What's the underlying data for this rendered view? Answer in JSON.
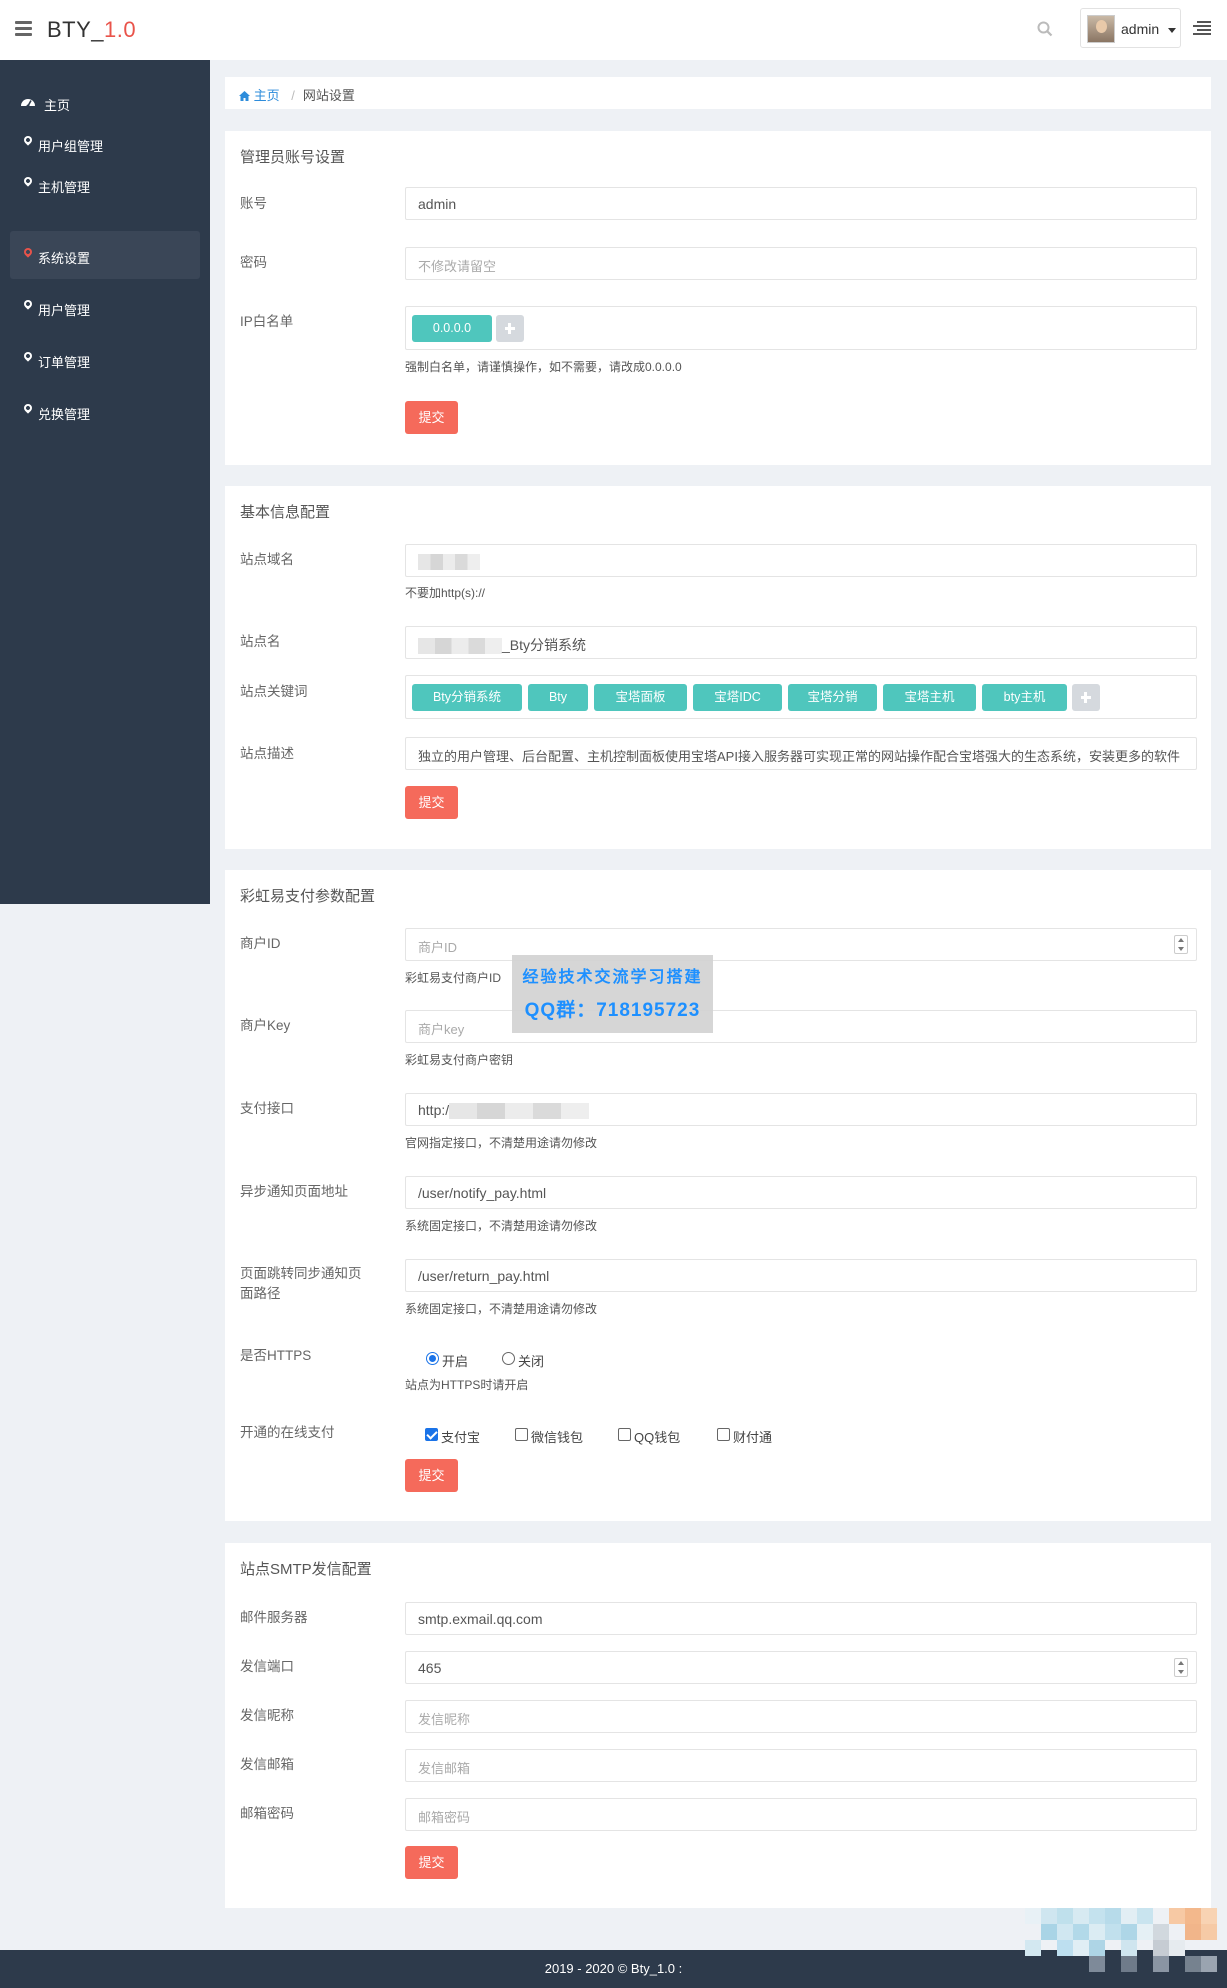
{
  "header": {
    "brand_prefix": "BTY_",
    "brand_version": "1.0",
    "username": "admin"
  },
  "sidebar": {
    "items": [
      {
        "label": "主页"
      },
      {
        "label": "用户组管理"
      },
      {
        "label": "主机管理"
      },
      {
        "label": "系统设置"
      },
      {
        "label": "用户管理"
      },
      {
        "label": "订单管理"
      },
      {
        "label": "兑换管理"
      }
    ],
    "active_index": 3
  },
  "breadcrumb": {
    "home": "主页",
    "current": "网站设置"
  },
  "admin_panel": {
    "title": "管理员账号设置",
    "account_label": "账号",
    "account_value": "admin",
    "password_label": "密码",
    "password_placeholder": "不修改请留空",
    "ip_label": "IP白名单",
    "ip_tags": [
      "0.0.0.0"
    ],
    "ip_help": "强制白名单，请谨慎操作，如不需要，请改成0.0.0.0",
    "submit": "提交"
  },
  "basic_panel": {
    "title": "基本信息配置",
    "domain_label": "站点域名",
    "domain_help": "不要加http(s)://",
    "sitename_label": "站点名",
    "sitename_value": "_Bty分销系统",
    "keywords_label": "站点关键词",
    "keywords": [
      "Bty分销系统",
      "Bty",
      "宝塔面板",
      "宝塔IDC",
      "宝塔分销",
      "宝塔主机",
      "bty主机"
    ],
    "desc_label": "站点描述",
    "desc_value": "独立的用户管理、后台配置、主机控制面板使用宝塔API接入服务器可实现正常的网站操作配合宝塔强大的生态系统，安装更多的软件",
    "submit": "提交"
  },
  "pay_panel": {
    "title": "彩虹易支付参数配置",
    "merchant_id_label": "商户ID",
    "merchant_id_placeholder": "商户ID",
    "merchant_id_help": "彩虹易支付商户ID",
    "merchant_key_label": "商户Key",
    "merchant_key_placeholder": "商户key",
    "merchant_key_help": "彩虹易支付商户密钥",
    "api_label": "支付接口",
    "api_value": "http:/",
    "api_help": "官网指定接口，不清楚用途请勿修改",
    "notify_label": "异步通知页面地址",
    "notify_value": "/user/notify_pay.html",
    "notify_help": "系统固定接口，不清楚用途请勿修改",
    "return_label_1": "页面跳转同步通知页",
    "return_label_2": "面路径",
    "return_value": "/user/return_pay.html",
    "return_help": "系统固定接口，不清楚用途请勿修改",
    "https_label": "是否HTTPS",
    "https_on": "开启",
    "https_off": "关闭",
    "https_help": "站点为HTTPS时请开启",
    "online_label": "开通的在线支付",
    "methods": [
      {
        "label": "支付宝",
        "checked": true
      },
      {
        "label": "微信钱包",
        "checked": false
      },
      {
        "label": "QQ钱包",
        "checked": false
      },
      {
        "label": "财付通",
        "checked": false
      }
    ],
    "submit": "提交"
  },
  "smtp_panel": {
    "title": "站点SMTP发信配置",
    "server_label": "邮件服务器",
    "server_value": "smtp.exmail.qq.com",
    "port_label": "发信端口",
    "port_value": "465",
    "nick_label": "发信昵称",
    "nick_placeholder": "发信昵称",
    "mail_label": "发信邮箱",
    "mail_placeholder": "发信邮箱",
    "pass_label": "邮箱密码",
    "pass_placeholder": "邮箱密码",
    "submit": "提交"
  },
  "watermark": {
    "line1": "经验技术交流学习搭建",
    "line2": "QQ群：718195723"
  },
  "footer": {
    "text": "2019 - 2020 © Bty_1.0 :"
  },
  "colors": {
    "accent": "#f56a5b",
    "sidebar": "#2d3a4b",
    "tag": "#4fc6bd",
    "link": "#2d8cdb"
  },
  "icons": [
    "menu-icon",
    "search-icon",
    "caret-down-icon",
    "list-menu-icon",
    "dashboard-icon",
    "map-marker-icon",
    "home-icon",
    "plus-icon"
  ]
}
